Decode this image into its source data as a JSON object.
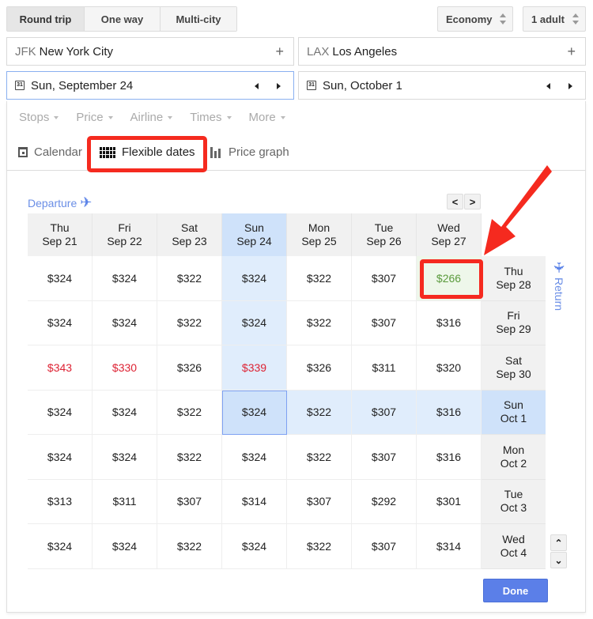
{
  "trip_type": {
    "options": [
      "Round trip",
      "One way",
      "Multi-city"
    ],
    "selected": "Round trip"
  },
  "cabin_class": "Economy",
  "passengers": "1 adult",
  "origin": {
    "code": "JFK",
    "city": "New York City",
    "add_icon": "plus-icon"
  },
  "destination": {
    "code": "LAX",
    "city": "Los Angeles",
    "add_icon": "plus-icon"
  },
  "departure_date": {
    "label": "Sun, September 24",
    "calendar_icon_text": "31"
  },
  "return_date": {
    "label": "Sun, October 1",
    "calendar_icon_text": "31"
  },
  "filters": [
    "Stops",
    "Price",
    "Airline",
    "Times",
    "More"
  ],
  "views": {
    "calendar": "Calendar",
    "flexible_dates": "Flexible dates",
    "price_graph": "Price graph",
    "selected": "Flexible dates"
  },
  "grid": {
    "departure_label": "Departure",
    "return_label": "Return",
    "prev_label": "<",
    "next_label": ">",
    "up_label": "^",
    "down_label": "v",
    "departure_dates": [
      {
        "day": "Thu",
        "date": "Sep 21"
      },
      {
        "day": "Fri",
        "date": "Sep 22"
      },
      {
        "day": "Sat",
        "date": "Sep 23"
      },
      {
        "day": "Sun",
        "date": "Sep 24"
      },
      {
        "day": "Mon",
        "date": "Sep 25"
      },
      {
        "day": "Tue",
        "date": "Sep 26"
      },
      {
        "day": "Wed",
        "date": "Sep 27"
      }
    ],
    "return_dates": [
      {
        "day": "Thu",
        "date": "Sep 28"
      },
      {
        "day": "Fri",
        "date": "Sep 29"
      },
      {
        "day": "Sat",
        "date": "Sep 30"
      },
      {
        "day": "Sun",
        "date": "Oct 1"
      },
      {
        "day": "Mon",
        "date": "Oct 2"
      },
      {
        "day": "Tue",
        "date": "Oct 3"
      },
      {
        "day": "Wed",
        "date": "Oct 4"
      }
    ],
    "selected_departure_index": 3,
    "selected_return_index": 3,
    "prices": [
      [
        "$324",
        "$324",
        "$322",
        "$324",
        "$322",
        "$307",
        "$266"
      ],
      [
        "$324",
        "$324",
        "$322",
        "$324",
        "$322",
        "$307",
        "$316"
      ],
      [
        "$343",
        "$330",
        "$326",
        "$339",
        "$326",
        "$311",
        "$320"
      ],
      [
        "$324",
        "$324",
        "$322",
        "$324",
        "$322",
        "$307",
        "$316"
      ],
      [
        "$324",
        "$324",
        "$322",
        "$324",
        "$322",
        "$307",
        "$316"
      ],
      [
        "$313",
        "$311",
        "$307",
        "$314",
        "$307",
        "$292",
        "$301"
      ],
      [
        "$324",
        "$324",
        "$322",
        "$324",
        "$322",
        "$307",
        "$314"
      ]
    ],
    "high_price_cells": [
      [
        2,
        0
      ],
      [
        2,
        1
      ],
      [
        2,
        3
      ]
    ],
    "lowest_price_cell": [
      0,
      6
    ]
  },
  "colors": {
    "accent": "#5b7fe8",
    "annotation": "#f52a1f",
    "high_price": "#dd2233",
    "low_price": "#5a9a3c",
    "selection": "#cfe2fa"
  },
  "done_label": "Done"
}
